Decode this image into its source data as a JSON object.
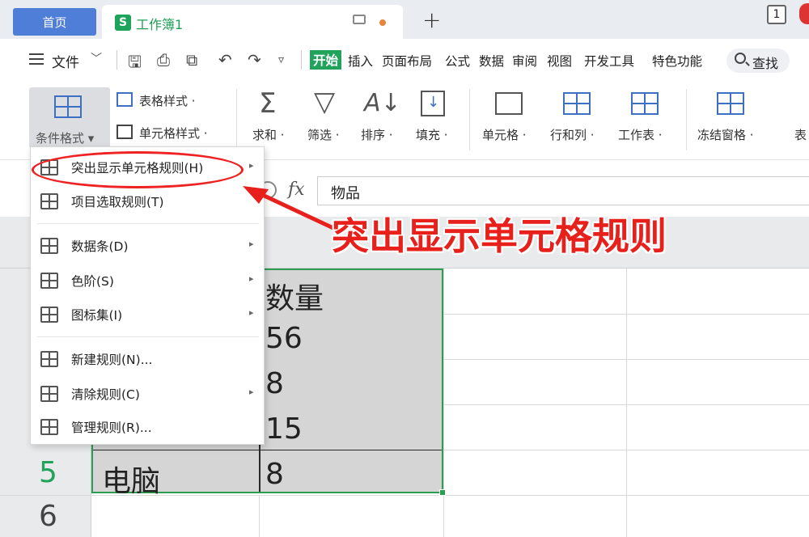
{
  "tabs": {
    "home": "首页",
    "doc_icon": "S",
    "doc_title": "工作簿1",
    "add": "+",
    "badge": "1"
  },
  "menu": {
    "file": "文件",
    "items": [
      "插入",
      "页面布局",
      "公式",
      "数据",
      "审阅",
      "视图",
      "开发工具",
      "特色功能"
    ],
    "start": "开始",
    "search": "查找"
  },
  "ribbon": {
    "cond_format": "条件格式",
    "table_style": "表格样式",
    "cell_style": "单元格样式",
    "tools": [
      "求和",
      "筛选",
      "排序",
      "填充",
      "单元格",
      "行和列",
      "工作表",
      "冻结窗格",
      "表"
    ]
  },
  "formula": {
    "fx": "fx",
    "value": "物品"
  },
  "dropdown": {
    "items": [
      {
        "label": "突出显示单元格规则(H)",
        "icon": "highlight-rules-icon",
        "submenu": true
      },
      {
        "label": "项目选取规则(T)",
        "icon": "top-rules-icon",
        "submenu": false
      },
      {
        "label": "数据条(D)",
        "icon": "data-bar-icon",
        "submenu": true
      },
      {
        "label": "色阶(S)",
        "icon": "color-scale-icon",
        "submenu": true
      },
      {
        "label": "图标集(I)",
        "icon": "icon-set-icon",
        "submenu": true
      },
      {
        "label": "新建规则(N)...",
        "icon": "new-rule-icon",
        "submenu": false
      },
      {
        "label": "清除规则(C)",
        "icon": "clear-rule-icon",
        "submenu": true
      },
      {
        "label": "管理规则(R)...",
        "icon": "manage-rule-icon",
        "submenu": false
      }
    ]
  },
  "sheet": {
    "rows": [
      "5",
      "6"
    ],
    "col_b": [
      "数量",
      "56",
      "8",
      "15",
      "8"
    ],
    "row5_a": "电脑"
  },
  "annotation": "突出显示单元格规则",
  "colors": {
    "accent_green": "#21a35b",
    "home_blue": "#4f7ed8",
    "annotation_red": "#e8201c"
  }
}
